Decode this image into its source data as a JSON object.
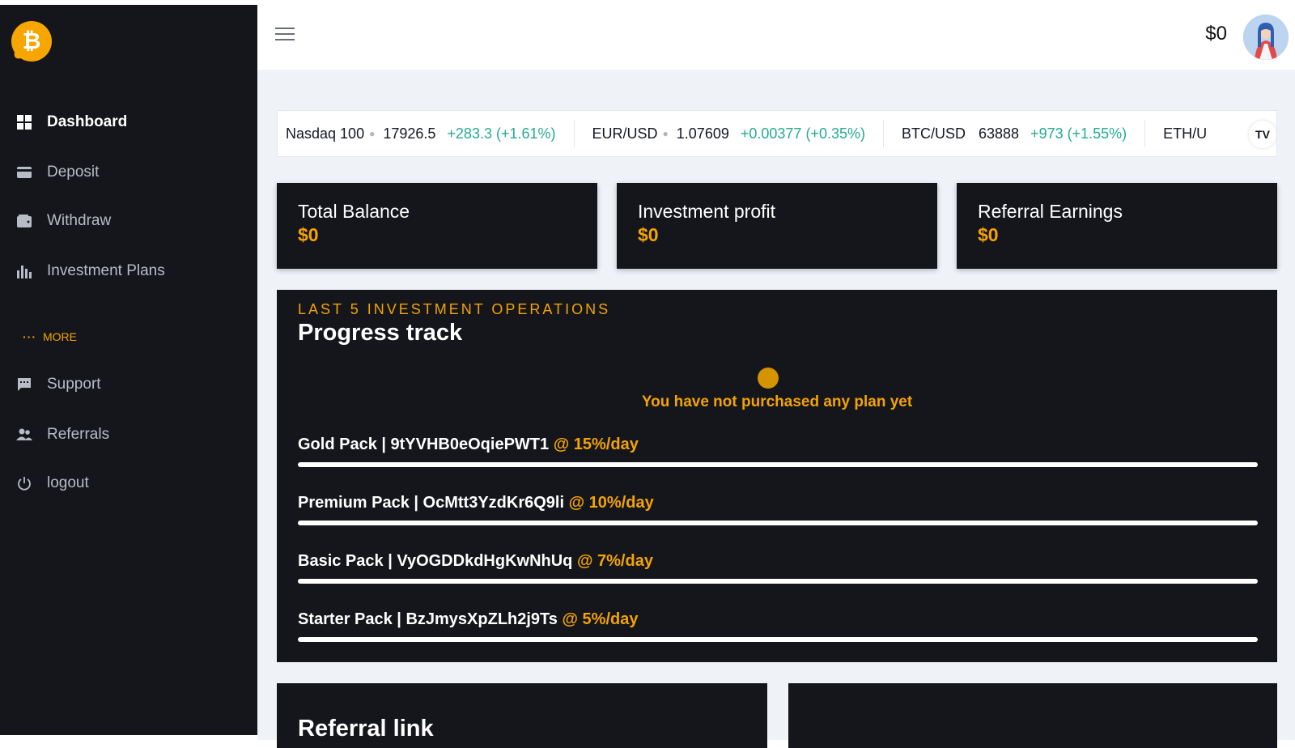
{
  "sidebar": {
    "items": [
      {
        "label": "Dashboard",
        "icon": "grid-icon"
      },
      {
        "label": "Deposit",
        "icon": "card-icon"
      },
      {
        "label": "Withdraw",
        "icon": "wallet-icon"
      },
      {
        "label": "Investment Plans",
        "icon": "bar-chart-icon"
      },
      {
        "label": "Support",
        "icon": "chat-icon"
      },
      {
        "label": "Referrals",
        "icon": "users-icon"
      },
      {
        "label": "logout",
        "icon": "power-icon"
      }
    ],
    "more_label": "MORE",
    "more_dots": "···"
  },
  "header": {
    "balance": "$0"
  },
  "ticker": {
    "items": [
      {
        "symbol": "Nasdaq 100",
        "price": "17926.5",
        "change": "+283.3 (+1.61%)"
      },
      {
        "symbol": "EUR/USD",
        "price": "1.07609",
        "change": "+0.00377 (+0.35%)"
      },
      {
        "symbol": "BTC/USD",
        "price": "63888",
        "change": "+973 (+1.55%)"
      },
      {
        "symbol": "ETH/U",
        "price": "",
        "change": ""
      }
    ],
    "brand": "TV"
  },
  "stats": [
    {
      "label": "Total Balance",
      "value": "$0"
    },
    {
      "label": "Investment profit",
      "value": "$0"
    },
    {
      "label": "Referral Earnings",
      "value": "$0"
    }
  ],
  "operations": {
    "kicker": "LAST 5 INVESTMENT OPERATIONS",
    "title": "Progress track",
    "empty_message": "You have not purchased any plan yet",
    "plans": [
      {
        "name": "Gold Pack | 9tYVHB0eOqiePWT1",
        "rate": "@ 15%/day",
        "progress": 0
      },
      {
        "name": "Premium Pack | OcMtt3YzdKr6Q9li",
        "rate": "@ 10%/day",
        "progress": 0
      },
      {
        "name": "Basic Pack | VyOGDDkdHgKwNhUq",
        "rate": "@ 7%/day",
        "progress": 0
      },
      {
        "name": "Starter Pack | BzJmysXpZLh2j9Ts",
        "rate": "@ 5%/day",
        "progress": 0
      }
    ]
  },
  "referral": {
    "title": "Referral link"
  },
  "colors": {
    "accent": "#f4a300",
    "dark": "#14161c",
    "positive": "#22ab94"
  }
}
